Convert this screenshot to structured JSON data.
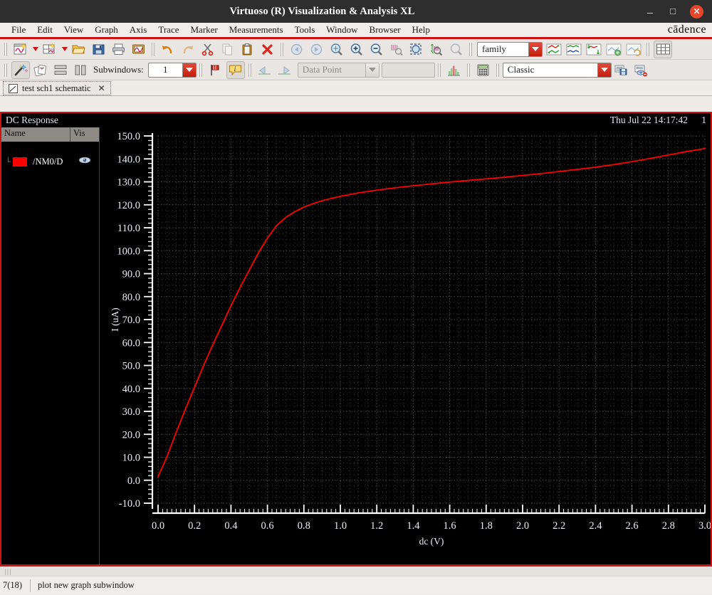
{
  "window": {
    "title": "Virtuoso (R) Visualization & Analysis XL",
    "minimize_label": "_",
    "maximize_label": "□",
    "close_label": "✕"
  },
  "menubar": {
    "items": [
      {
        "label": "File",
        "mnemonic": "F"
      },
      {
        "label": "Edit",
        "mnemonic": "E"
      },
      {
        "label": "View",
        "mnemonic": "V"
      },
      {
        "label": "Graph",
        "mnemonic": "G"
      },
      {
        "label": "Axis",
        "mnemonic": "A"
      },
      {
        "label": "Trace",
        "mnemonic": "T"
      },
      {
        "label": "Marker",
        "mnemonic": "M"
      },
      {
        "label": "Measurements",
        "mnemonic": "e"
      },
      {
        "label": "Tools",
        "mnemonic": "o"
      },
      {
        "label": "Window",
        "mnemonic": "W"
      },
      {
        "label": "Browser",
        "mnemonic": "B"
      },
      {
        "label": "Help",
        "mnemonic": "H"
      }
    ],
    "brand": "cādence"
  },
  "toolbar1": {
    "buttons": [
      "new-graph-window-icon",
      "new-graph-window-dropdown",
      "new-subwindow-icon",
      "new-subwindow-dropdown",
      "open-icon",
      "save-icon",
      "print-icon",
      "print-preview-icon",
      "undo-icon",
      "redo-icon",
      "cut-icon",
      "copy-icon",
      "paste-icon",
      "delete-icon",
      "zoom-back-icon",
      "zoom-forward-icon",
      "zoom-fit-icon",
      "zoom-in-icon",
      "zoom-out-icon",
      "zoom-x-icon",
      "zoom-area-icon",
      "zoom-y-icon",
      "zoom-region-icon"
    ],
    "family_combo": {
      "value": "family",
      "label": "family"
    },
    "trace_buttons": [
      "swap-axes-icon",
      "strip-mode-icon",
      "append-mode-icon",
      "add-trace-icon",
      "refresh-trace-icon"
    ],
    "grid_button": "grid-icon"
  },
  "toolbar2": {
    "buttons": [
      "wand-icon",
      "cards-icon",
      "horizontal-strip-icon",
      "vertical-strip-icon"
    ],
    "subwindows_label": "Subwindows:",
    "subwindows_value": "1",
    "marker_buttons": [
      "flag-marker-icon",
      "info-marker-icon"
    ],
    "nav_buttons": [
      "prev-marker-icon",
      "next-marker-icon"
    ],
    "datapoint_combo": {
      "value": "Data Point"
    },
    "datapoint_field": "",
    "histogram_button": "histogram-icon",
    "calculator_button": "calculator-icon",
    "theme_combo": {
      "value": "Classic"
    },
    "save_template_button": "save-template-icon",
    "hide-preview-button": "hide-preview-icon"
  },
  "tabs": [
    {
      "label": "test sch1 schematic",
      "icon": "schematic-icon",
      "close": "✕",
      "active": true
    }
  ],
  "plot": {
    "title": "DC Response",
    "date": "Thu Jul 22 14:17:42",
    "number": "1"
  },
  "trace_panel": {
    "columns": [
      "Name",
      "Vis"
    ],
    "rows": [
      {
        "name": "/NM0/D",
        "color": "#ff0000",
        "visible": true,
        "vis_icon": "eye-icon"
      }
    ]
  },
  "statusbar": {
    "count": "7(18)",
    "message": "plot new graph subwindow"
  },
  "chart_data": {
    "type": "line",
    "title": "DC Response",
    "xlabel": "dc (V)",
    "ylabel": "I (uA)",
    "xlim": [
      0.0,
      3.0
    ],
    "ylim": [
      -10.0,
      150.0
    ],
    "xticks": [
      0.0,
      0.2,
      0.4,
      0.6,
      0.8,
      1.0,
      1.2,
      1.4,
      1.6,
      1.8,
      2.0,
      2.2,
      2.4,
      2.6,
      2.8,
      3.0
    ],
    "yticks": [
      -10.0,
      0.0,
      10.0,
      20.0,
      30.0,
      40.0,
      50.0,
      60.0,
      70.0,
      80.0,
      90.0,
      100.0,
      110.0,
      120.0,
      130.0,
      140.0,
      150.0
    ],
    "grid": true,
    "background": "#000000",
    "legend_position": "left-panel",
    "series": [
      {
        "name": "/NM0/D",
        "color": "#ff0000",
        "x": [
          0.0,
          0.05,
          0.1,
          0.15,
          0.2,
          0.25,
          0.3,
          0.35,
          0.4,
          0.45,
          0.5,
          0.55,
          0.6,
          0.65,
          0.7,
          0.75,
          0.8,
          0.85,
          0.9,
          0.95,
          1.0,
          1.1,
          1.2,
          1.3,
          1.4,
          1.5,
          1.6,
          1.7,
          1.8,
          1.9,
          2.0,
          2.1,
          2.2,
          2.3,
          2.4,
          2.5,
          2.6,
          2.7,
          2.8,
          2.9,
          3.0
        ],
        "y": [
          1.5,
          10.5,
          21.0,
          31.0,
          40.5,
          50.0,
          59.0,
          67.5,
          76.0,
          84.0,
          91.5,
          99.0,
          105.5,
          111.0,
          114.5,
          117.0,
          119.0,
          120.5,
          121.8,
          122.8,
          123.7,
          125.2,
          126.4,
          127.4,
          128.3,
          129.1,
          129.9,
          130.6,
          131.3,
          132.0,
          132.8,
          133.6,
          134.5,
          135.4,
          136.4,
          137.5,
          138.8,
          140.2,
          141.7,
          143.2,
          144.5
        ]
      }
    ]
  }
}
